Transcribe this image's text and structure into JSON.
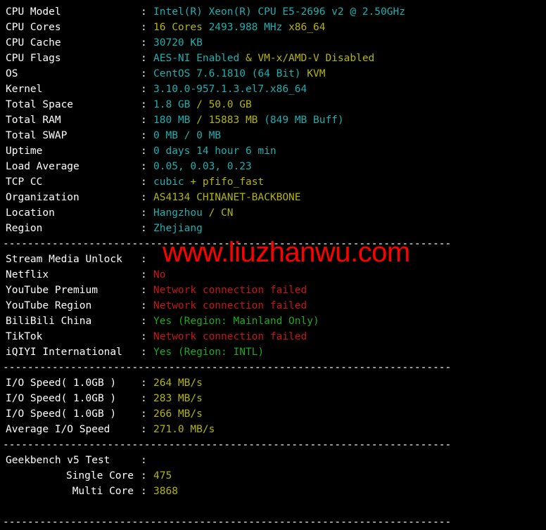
{
  "terminal": {
    "divider_text": "-------------------------------------------------------------------------",
    "colon": ":",
    "sections": [
      {
        "id": "system-info",
        "rows": [
          {
            "label": "CPU Model",
            "segments": [
              {
                "text": "Intel(R) Xeon(R) CPU E5-2696 v2 @ 2.50GHz",
                "color": "cyan"
              }
            ]
          },
          {
            "label": "CPU Cores",
            "segments": [
              {
                "text": "16 Cores ",
                "color": "yellow"
              },
              {
                "text": "2493.988 MHz ",
                "color": "cyan"
              },
              {
                "text": "x86_64",
                "color": "yellow"
              }
            ]
          },
          {
            "label": "CPU Cache",
            "segments": [
              {
                "text": "30720 KB",
                "color": "cyan"
              }
            ]
          },
          {
            "label": "CPU Flags",
            "segments": [
              {
                "text": "AES-NI Enabled ",
                "color": "cyan"
              },
              {
                "text": "& VM-x/AMD-V Disabled",
                "color": "yellow"
              }
            ]
          },
          {
            "label": "OS",
            "segments": [
              {
                "text": "CentOS 7.6.1810 (64 Bit) ",
                "color": "cyan"
              },
              {
                "text": "KVM",
                "color": "yellow"
              }
            ]
          },
          {
            "label": "Kernel",
            "segments": [
              {
                "text": "3.10.0-957.1.3.el7.x86_64",
                "color": "cyan"
              }
            ]
          },
          {
            "label": "Total Space",
            "segments": [
              {
                "text": "1.8 GB ",
                "color": "cyan"
              },
              {
                "text": "/ ",
                "color": "yellow"
              },
              {
                "text": "50.0 GB",
                "color": "yellow"
              }
            ]
          },
          {
            "label": "Total RAM",
            "segments": [
              {
                "text": "180 MB ",
                "color": "cyan"
              },
              {
                "text": "/ 15883 MB ",
                "color": "yellow"
              },
              {
                "text": "(849 MB Buff)",
                "color": "cyan"
              }
            ]
          },
          {
            "label": "Total SWAP",
            "segments": [
              {
                "text": "0 MB / 0 MB",
                "color": "cyan"
              }
            ]
          },
          {
            "label": "Uptime",
            "segments": [
              {
                "text": "0 days 14 hour 6 min",
                "color": "cyan"
              }
            ]
          },
          {
            "label": "Load Average",
            "segments": [
              {
                "text": "0.05, 0.03, 0.23",
                "color": "cyan"
              }
            ]
          },
          {
            "label": "TCP CC",
            "segments": [
              {
                "text": "cubic ",
                "color": "cyan"
              },
              {
                "text": "+ pfifo_fast",
                "color": "yellow"
              }
            ]
          },
          {
            "label": "Organization",
            "segments": [
              {
                "text": "AS4134 CHINANET-BACKBONE",
                "color": "yellow"
              }
            ]
          },
          {
            "label": "Location",
            "segments": [
              {
                "text": "Hangzhou ",
                "color": "cyan"
              },
              {
                "text": "/ ",
                "color": "yellow"
              },
              {
                "text": "CN",
                "color": "yellow"
              }
            ]
          },
          {
            "label": "Region",
            "segments": [
              {
                "text": "Zhejiang",
                "color": "cyan"
              }
            ]
          }
        ]
      },
      {
        "id": "stream-media-unlock",
        "rows": [
          {
            "label": "Stream Media Unlock",
            "segments": []
          },
          {
            "label": "Netflix",
            "segments": [
              {
                "text": "No",
                "color": "red"
              }
            ]
          },
          {
            "label": "YouTube Premium",
            "segments": [
              {
                "text": "Network connection failed",
                "color": "red"
              }
            ]
          },
          {
            "label": "YouTube Region",
            "segments": [
              {
                "text": "Network connection failed",
                "color": "red"
              }
            ]
          },
          {
            "label": "BiliBili China",
            "segments": [
              {
                "text": "Yes (Region: Mainland Only)",
                "color": "green"
              }
            ]
          },
          {
            "label": "TikTok",
            "segments": [
              {
                "text": "Network connection failed",
                "color": "red"
              }
            ]
          },
          {
            "label": "iQIYI International",
            "segments": [
              {
                "text": "Yes (Region: INTL)",
                "color": "green"
              }
            ]
          }
        ]
      },
      {
        "id": "io-speed",
        "rows": [
          {
            "label": "I/O Speed( 1.0GB )",
            "segments": [
              {
                "text": "264 MB/s",
                "color": "yellow"
              }
            ]
          },
          {
            "label": "I/O Speed( 1.0GB )",
            "segments": [
              {
                "text": "283 MB/s",
                "color": "yellow"
              }
            ]
          },
          {
            "label": "I/O Speed( 1.0GB )",
            "segments": [
              {
                "text": "266 MB/s",
                "color": "yellow"
              }
            ]
          },
          {
            "label": "Average I/O Speed",
            "segments": [
              {
                "text": "271.0 MB/s",
                "color": "yellow"
              }
            ]
          }
        ]
      },
      {
        "id": "geekbench",
        "rows": [
          {
            "label": "Geekbench v5 Test",
            "segments": []
          },
          {
            "label": "Single Core",
            "indent": true,
            "segments": [
              {
                "text": "475",
                "color": "yellow"
              }
            ]
          },
          {
            "label": "Multi Core",
            "indent": true,
            "segments": [
              {
                "text": "3868",
                "color": "yellow"
              }
            ]
          }
        ]
      }
    ]
  },
  "watermark": {
    "text": "www.liuzhanwu.com",
    "color": "#fe0000"
  },
  "colors": {
    "background": "#000000",
    "cyan": "#1cb0b0",
    "yellow": "#b5b500",
    "red": "#c81414",
    "green": "#1aaa1a",
    "white": "#ffffff"
  }
}
